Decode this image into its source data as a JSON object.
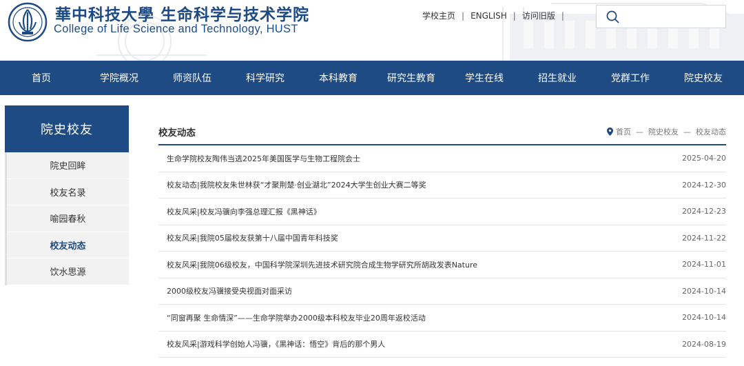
{
  "header": {
    "title_cn": "華中科技大學  生命科学与技术学院",
    "title_en": "College of Life Science and Technology, HUST",
    "links": [
      "学校主页",
      "ENGLISH",
      "访问旧版"
    ],
    "search_placeholder": ""
  },
  "nav": [
    "首页",
    "学院概况",
    "师资队伍",
    "科学研究",
    "本科教育",
    "研究生教育",
    "学生在线",
    "招生就业",
    "党群工作",
    "院史校友"
  ],
  "sidebar": {
    "title": "院史校友",
    "items": [
      "院史回眸",
      "校友名录",
      "喻园春秋",
      "校友动态",
      "饮水思源"
    ],
    "active_index": 3
  },
  "main": {
    "title": "校友动态",
    "breadcrumb": [
      "首页",
      "院史校友",
      "校友动态"
    ],
    "news": [
      {
        "title": "生命学院校友陶伟当选2025年美国医学与生物工程院会士",
        "date": "2025-04-20"
      },
      {
        "title": "校友动态|我院校友朱世林获“才聚荆楚·创业湖北”2024大学生创业大赛二等奖",
        "date": "2024-12-30"
      },
      {
        "title": "校友风采|校友冯骥向李强总理汇报《黑神话》",
        "date": "2024-12-23"
      },
      {
        "title": "校友风采|我院05届校友获第十八届中国青年科技奖",
        "date": "2024-11-22"
      },
      {
        "title": "校友风采|我院06级校友，中国科学院深圳先进技术研究院合成生物学研究所胡政发表Nature",
        "date": "2024-11-01"
      },
      {
        "title": "2000级校友冯骥接受央视面对面采访",
        "date": "2024-10-14"
      },
      {
        "title": "“同窗再聚 生命情深”——生命学院举办2000级本科校友毕业20周年返校活动",
        "date": "2024-10-14"
      },
      {
        "title": "校友风采|游戏科学创始人冯骥，《黑神话：悟空》背后的那个男人",
        "date": "2024-08-19"
      }
    ]
  },
  "colors": {
    "primary": "#1e4b84",
    "sidebar_bg": "#f2f2f2"
  }
}
